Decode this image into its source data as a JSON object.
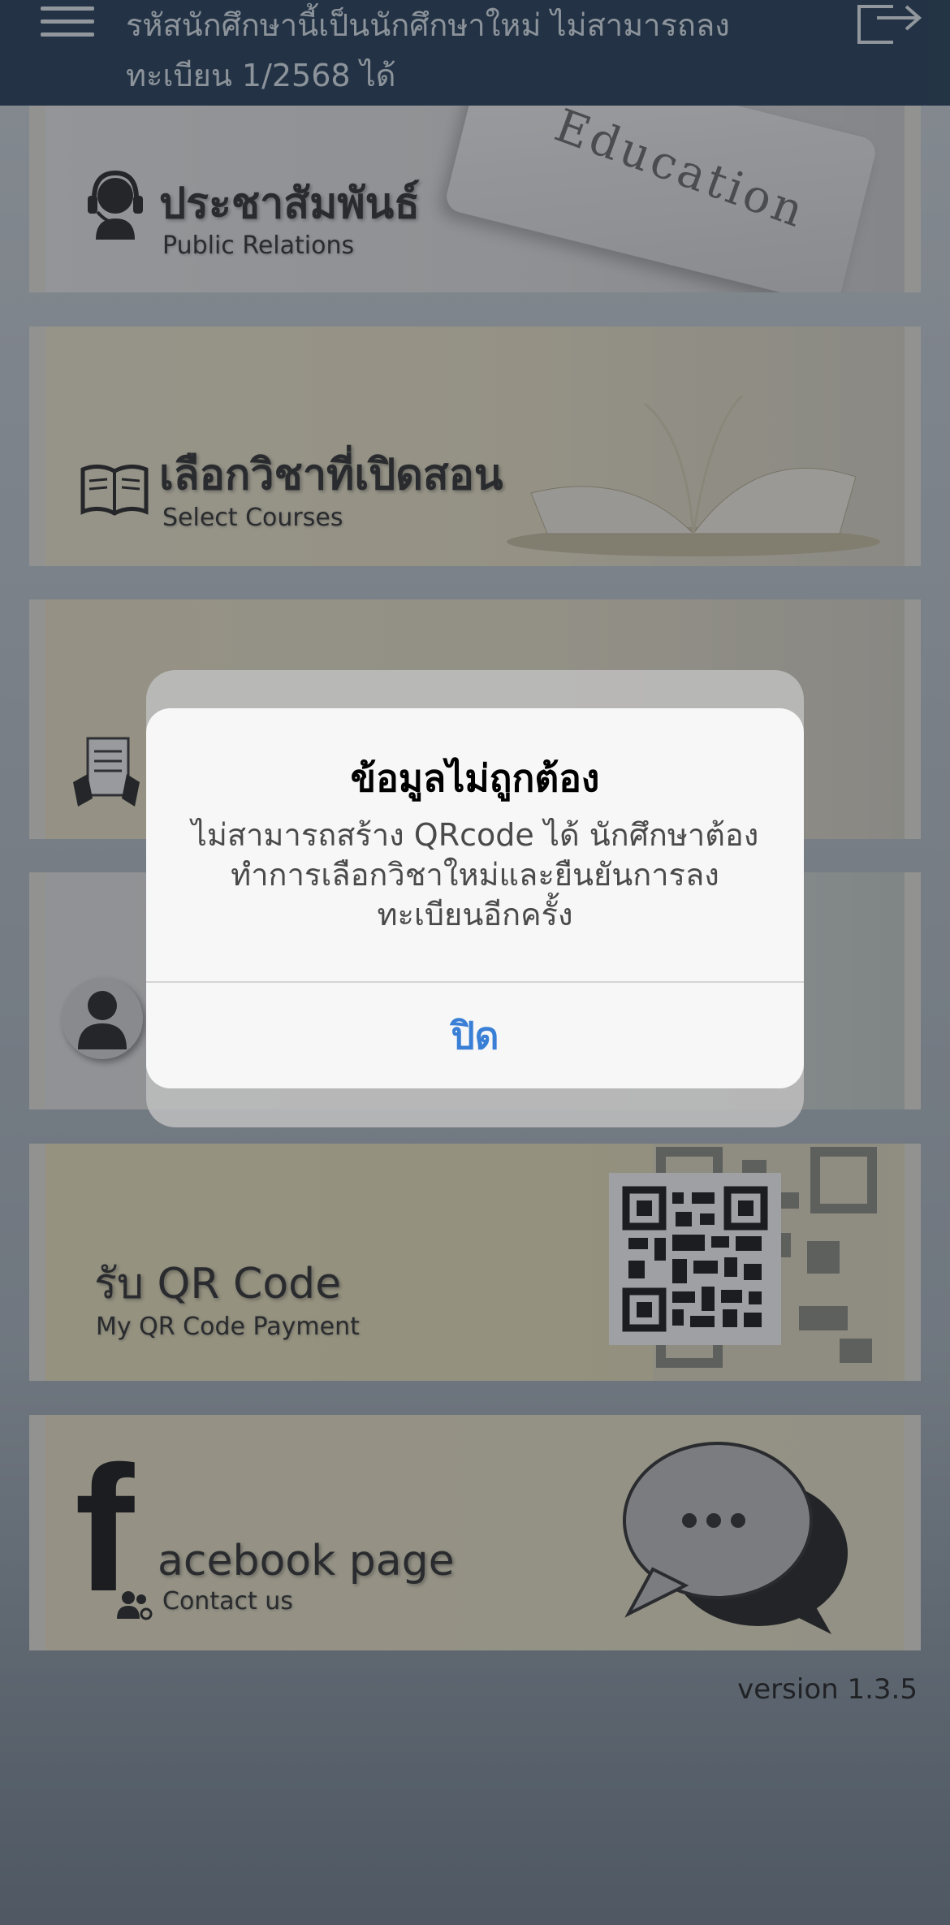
{
  "header": {
    "message": "รหัสนักศึกษานี้เป็นนักศึกษาใหม่ ไม่สามารถลงทะเบียน 1/2568 ได้"
  },
  "cards": {
    "pr": {
      "title": "ประชาสัมพันธ์",
      "subtitle": "Public Relations",
      "image_text": "Education"
    },
    "courses": {
      "title": "เลือกวิชาที่เปิดสอน",
      "subtitle": "Select Courses"
    },
    "qr": {
      "title": "รับ QR Code",
      "subtitle": "My QR Code Payment"
    },
    "facebook": {
      "f_letter": "f",
      "title": "acebook page",
      "subtitle": "Contact us"
    }
  },
  "version": "version 1.3.5",
  "alert": {
    "title": "ข้อมูลไม่ถูกต้อง",
    "message": "ไม่สามารถสร้าง QRcode ได้ นักศึกษาต้องทำการเลือกวิชาใหม่และยืนยันการลงทะเบียนอีกครั้ง",
    "button": "ปิด"
  },
  "colors": {
    "header_bg": "#1f3a55",
    "alert_button": "#3a7fd6",
    "overlay": "rgba(40,44,50,0.45)"
  }
}
